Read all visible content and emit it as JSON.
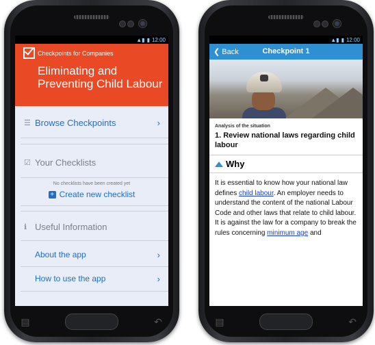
{
  "status_time": "12:00",
  "left": {
    "brand": "Checkpoints for Companies",
    "title": "Eliminating and Preventing Child Labour",
    "browse_label": "Browse Checkpoints",
    "checklists_label": "Your Checklists",
    "no_checklists_note": "No checklists have been created yet",
    "create_label": "Create new checklist",
    "useful_label": "Useful Information",
    "about_label": "About the app",
    "howto_label": "How to use the app"
  },
  "right": {
    "back_label": "Back",
    "header_title": "Checkpoint 1",
    "section_label": "Analysis of the situation",
    "heading": "1. Review national laws regarding child labour",
    "why_label": "Why",
    "p1": "It is essential to know how your national law defines ",
    "link1": "child labour",
    "p2": ". An employer needs to understand the content of the national Labour Code and other laws that relate to child labour. It is against the law for a company to break the rules concerning ",
    "link2": "minimum age",
    "p3": " and"
  },
  "colors": {
    "hero": "#e94a25",
    "accent": "#1e6fc6",
    "header": "#2f8fd3"
  }
}
